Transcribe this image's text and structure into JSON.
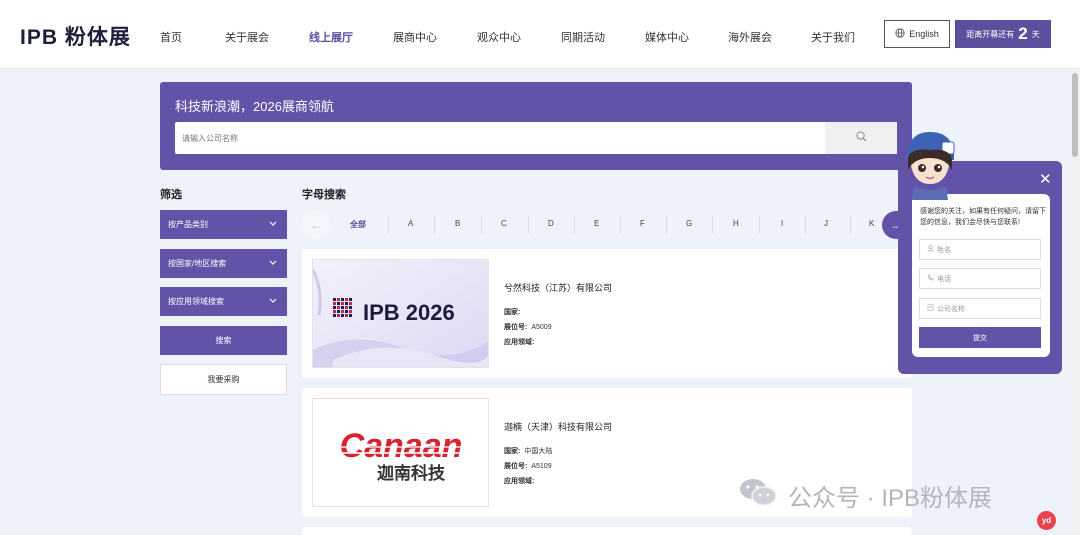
{
  "header": {
    "logo": "IPB 粉体展",
    "nav": [
      {
        "label": "首页"
      },
      {
        "label": "关于展会"
      },
      {
        "label": "线上展厅",
        "active": true
      },
      {
        "label": "展商中心"
      },
      {
        "label": "观众中心"
      },
      {
        "label": "同期活动"
      },
      {
        "label": "媒体中心"
      },
      {
        "label": "海外展会"
      },
      {
        "label": "关于我们"
      }
    ],
    "language_label": "English",
    "countdown_prefix": "距离开幕还有",
    "countdown_value": "2",
    "countdown_unit": "天"
  },
  "banner": {
    "title": "科技新浪潮，2026展商领航",
    "search_placeholder": "请输入公司名称"
  },
  "filters": {
    "title": "筛选",
    "dropdowns": [
      {
        "label": "按产品类别"
      },
      {
        "label": "按国家/地区搜索"
      },
      {
        "label": "按应用领域搜索"
      }
    ],
    "search_label": "搜索",
    "purchase_label": "我要采购"
  },
  "alpha": {
    "title": "字母搜索",
    "items": [
      "全部",
      "A",
      "B",
      "C",
      "D",
      "E",
      "F",
      "G",
      "H",
      "I",
      "J",
      "K"
    ],
    "active": "全部"
  },
  "exhibitors": [
    {
      "name": "兮然科技（江苏）有限公司",
      "country_label": "国家:",
      "country": "",
      "booth_label": "展位号:",
      "booth": "A5009",
      "field_label": "应用领域:",
      "field": "",
      "logo_text": "IPB 2026"
    },
    {
      "name": "迦楠（天津）科技有限公司",
      "country_label": "国家:",
      "country": "中国大陆",
      "booth_label": "展位号:",
      "booth": "A5109",
      "field_label": "应用领域:",
      "field": "",
      "logo_text": "Canaan",
      "logo_subtext": "迦南科技"
    }
  ],
  "chat": {
    "message": "感谢您的关注，如果有任何疑问，请留下您的信息，我们会尽快与您联系!",
    "name_placeholder": "姓名",
    "phone_placeholder": "电话",
    "company_placeholder": "公司名称",
    "submit_label": "提交"
  },
  "watermark": {
    "text": "公众号 · IPB粉体展",
    "badge": "yd"
  },
  "colors": {
    "primary": "#6253a8",
    "header_bg": "#ffffff",
    "page_bg": "#eef3fa"
  }
}
